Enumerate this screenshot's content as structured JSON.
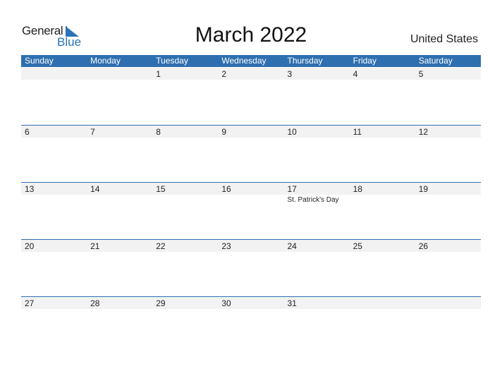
{
  "logo": {
    "general": "General",
    "blue": "Blue"
  },
  "title": "March 2022",
  "country": "United States",
  "colors": {
    "accent": "#2e6fb0",
    "stripe": "#f2f2f2"
  },
  "weekdays": [
    "Sunday",
    "Monday",
    "Tuesday",
    "Wednesday",
    "Thursday",
    "Friday",
    "Saturday"
  ],
  "weeks": [
    {
      "days": [
        "",
        "",
        "1",
        "2",
        "3",
        "4",
        "5"
      ],
      "events": [
        "",
        "",
        "",
        "",
        "",
        "",
        ""
      ]
    },
    {
      "days": [
        "6",
        "7",
        "8",
        "9",
        "10",
        "11",
        "12"
      ],
      "events": [
        "",
        "",
        "",
        "",
        "",
        "",
        ""
      ]
    },
    {
      "days": [
        "13",
        "14",
        "15",
        "16",
        "17",
        "18",
        "19"
      ],
      "events": [
        "",
        "",
        "",
        "",
        "St. Patrick's Day",
        "",
        ""
      ]
    },
    {
      "days": [
        "20",
        "21",
        "22",
        "23",
        "24",
        "25",
        "26"
      ],
      "events": [
        "",
        "",
        "",
        "",
        "",
        "",
        ""
      ]
    },
    {
      "days": [
        "27",
        "28",
        "29",
        "30",
        "31",
        "",
        ""
      ],
      "events": [
        "",
        "",
        "",
        "",
        "",
        "",
        ""
      ]
    }
  ]
}
